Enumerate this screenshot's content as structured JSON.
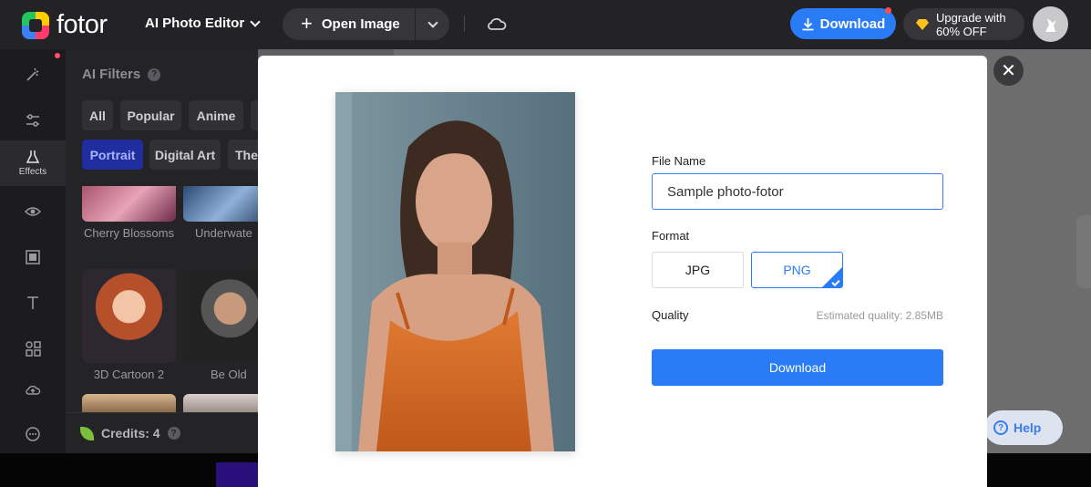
{
  "header": {
    "brand": "fotor",
    "app_menu": "AI Photo Editor",
    "open_image": "Open Image",
    "download": "Download",
    "upgrade_line1": "Upgrade with",
    "upgrade_line2": "60% OFF"
  },
  "rail": {
    "effects_label": "Effects"
  },
  "panel": {
    "title": "AI Filters",
    "chips_row1": [
      "All",
      "Popular",
      "Anime"
    ],
    "chips_row2": [
      "Portrait",
      "Digital Art",
      "The"
    ],
    "thumbs": [
      {
        "label": "Cherry Blossoms"
      },
      {
        "label": "Underwate"
      },
      {
        "label": "3D Cartoon 2"
      },
      {
        "label": "Be Old"
      }
    ],
    "credits": "Credits: 4"
  },
  "modal": {
    "file_name_label": "File Name",
    "file_name_value": "Sample photo-fotor",
    "format_label": "Format",
    "formats": [
      "JPG",
      "PNG"
    ],
    "selected_format": "PNG",
    "quality_label": "Quality",
    "estimated": "Estimated quality: 2.85MB",
    "download": "Download"
  },
  "help": "Help",
  "colors": {
    "accent": "#2a7cf6",
    "topbar": "#232326",
    "selected_chip": "#1f2d9e"
  }
}
